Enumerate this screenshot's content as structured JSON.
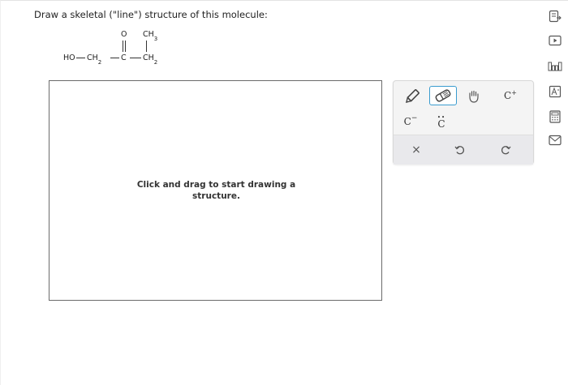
{
  "question": {
    "prompt": "Draw a skeletal (\"line\") structure of this molecule:"
  },
  "molecule": {
    "ho": "HO",
    "ch2_a": "CH",
    "sub2": "2",
    "carbonyl_c": "C",
    "oxygen": "O",
    "ch3": "CH",
    "sub3": "3",
    "ch2_b": "CH"
  },
  "canvas": {
    "hint_line1": "Click and drag to start drawing a",
    "hint_line2": "structure."
  },
  "palette": {
    "carbanion_label": "C",
    "carbanion_sup": "−",
    "carbene_label": "C",
    "carbene_dots": "••",
    "carbocation_label": "C",
    "carbocation_sup": "+",
    "delete_label": "×",
    "selected_tool": "eraser",
    "accent_color": "#3a9ccf"
  },
  "sidebar": {
    "icons": [
      "explanation-icon",
      "video-icon",
      "periodic-table-icon",
      "textbook-icon",
      "calculator-icon",
      "message-icon"
    ]
  }
}
